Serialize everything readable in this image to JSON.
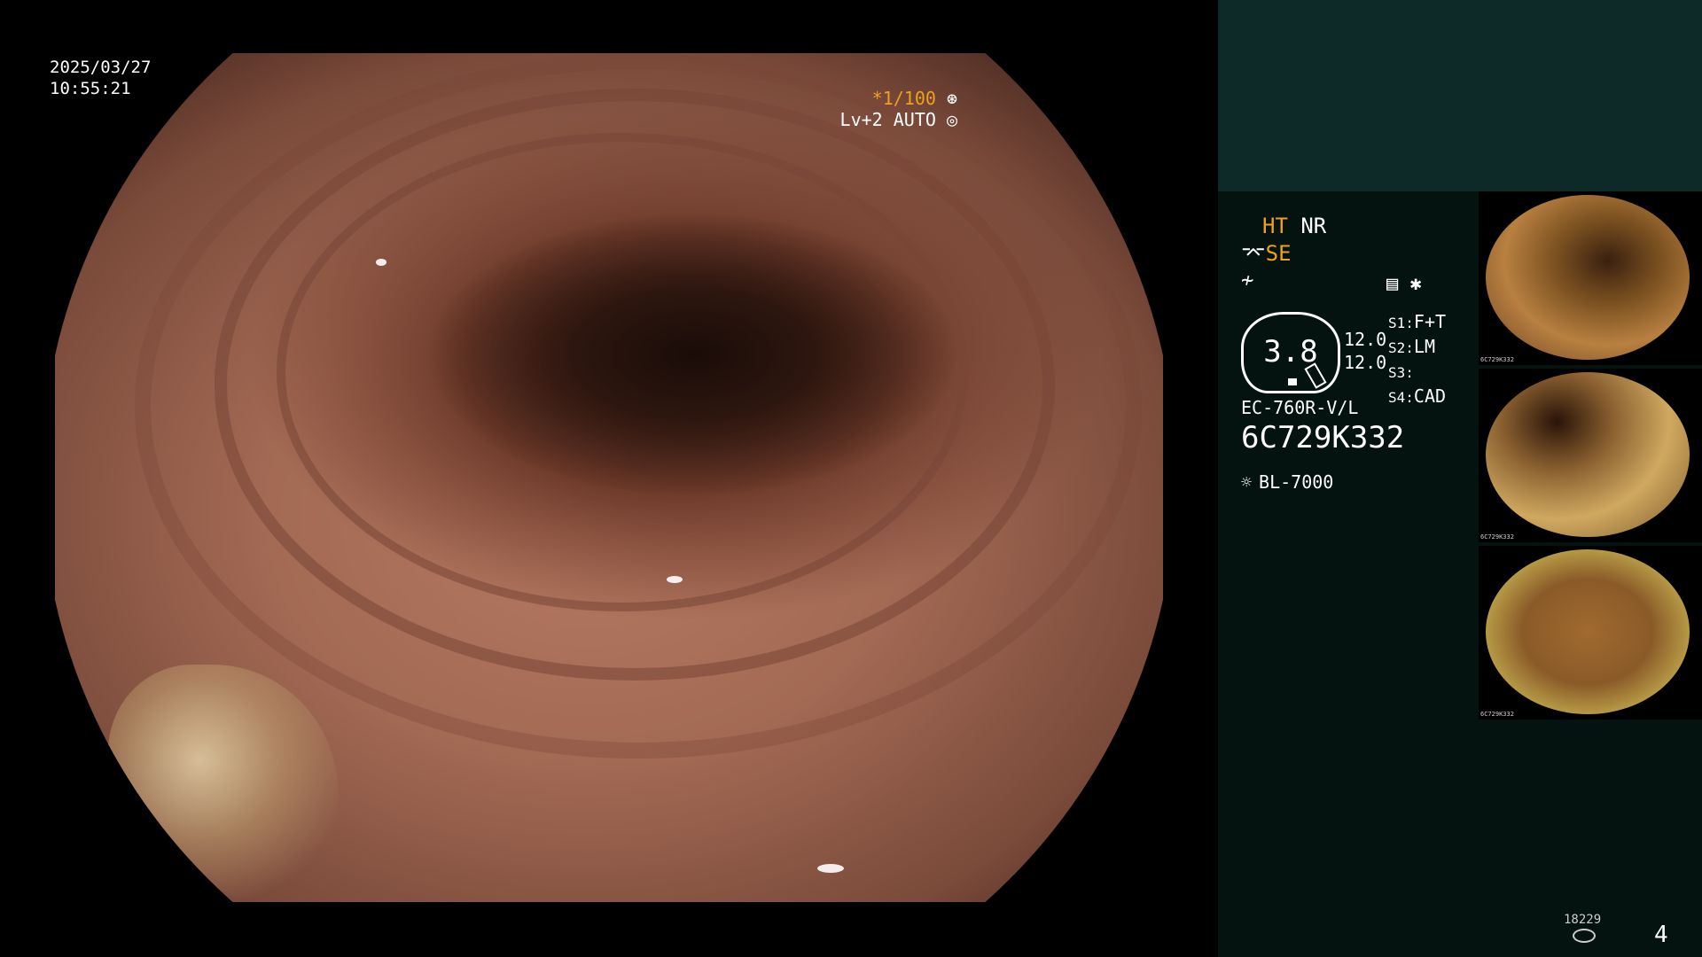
{
  "overlay": {
    "date": "2025/03/27",
    "time": "10:55:21",
    "shutter": "*1/100",
    "enhance": "Lv+2 AUTO"
  },
  "panel": {
    "mode_ht": "HT",
    "mode_nr": "NR",
    "mode_se": "SE",
    "zoom_value": "3.8",
    "level_1": "12.0",
    "level_2": "12.0",
    "switches": [
      {
        "key": "S1:",
        "value": "F+T"
      },
      {
        "key": "S2:",
        "value": "LM"
      },
      {
        "key": "S3:",
        "value": ""
      },
      {
        "key": "S4:",
        "value": "CAD"
      }
    ],
    "scope_model": "EC-760R-V/L",
    "scope_serial": "6C729K332",
    "light_source": "BL-7000"
  },
  "thumbnails": [
    {
      "caption": "6C729K332"
    },
    {
      "caption": "6C729K332"
    },
    {
      "caption": "6C729K332"
    }
  ],
  "footer": {
    "record_count": "18229",
    "page_number": "4"
  },
  "colors": {
    "accent_orange": "#f0a020",
    "panel_dark": "#041210",
    "panel_top": "#0e2a28"
  }
}
